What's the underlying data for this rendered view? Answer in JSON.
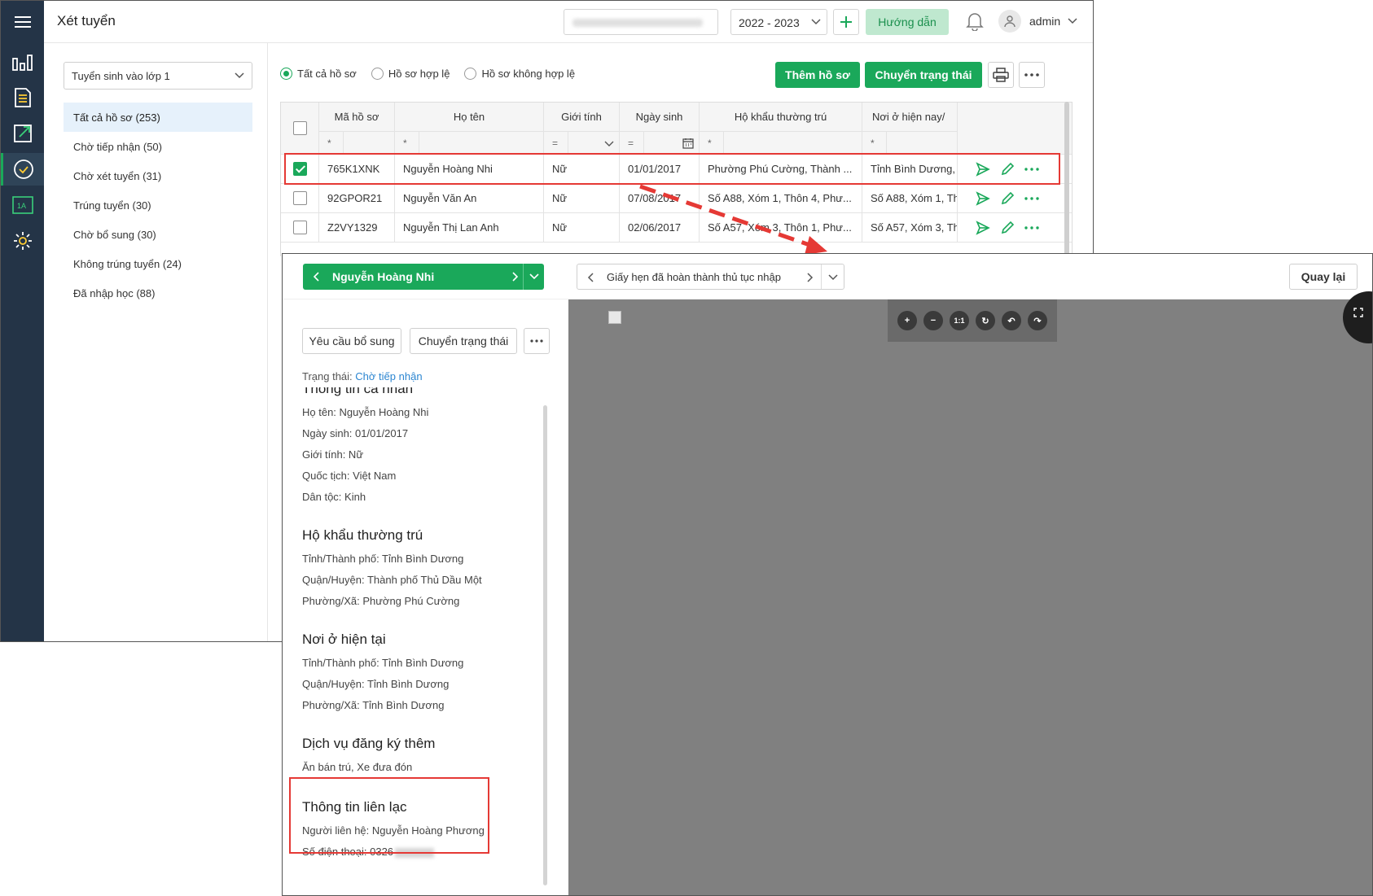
{
  "app": {
    "page_title": "Xét tuyển",
    "school_select_value": "",
    "year": "2022 - 2023",
    "guide_label": "Hướng dẫn",
    "user": "admin"
  },
  "nav_icons": [
    "dashboard-chart-icon",
    "document-list-icon",
    "export-icon",
    "check-circle-icon",
    "class-1a-icon",
    "settings-gear-icon"
  ],
  "left": {
    "admission_select": "Tuyển sinh vào lớp 1",
    "categories": [
      {
        "label": "Tất cả hồ sơ (253)"
      },
      {
        "label": "Chờ tiếp nhận (50)"
      },
      {
        "label": "Chờ xét tuyển (31)"
      },
      {
        "label": "Trúng tuyển (30)"
      },
      {
        "label": "Chờ bổ sung (30)"
      },
      {
        "label": "Không trúng tuyển (24)"
      },
      {
        "label": "Đã nhập học (88)"
      }
    ]
  },
  "filters": {
    "all": "Tất cả hồ sơ",
    "valid": "Hồ sơ hợp lệ",
    "invalid": "Hồ sơ không hợp lệ"
  },
  "toolbar": {
    "add_label": "Thêm hồ sơ",
    "change_status_label": "Chuyển trạng thái"
  },
  "table": {
    "headers": [
      "Mã hồ sơ",
      "Họ tên",
      "Giới tính",
      "Ngày sinh",
      "Hộ khẩu thường trú",
      "Nơi ở hiện nay/ "
    ],
    "filter_ops": [
      "*",
      "*",
      "=",
      "=",
      "*",
      "*"
    ],
    "rows": [
      {
        "code": "765K1XNK",
        "name": "Nguyễn Hoàng Nhi",
        "gender": "Nữ",
        "dob": "01/01/2017",
        "address": "Phường Phú Cường, Thành ...",
        "current": "Tỉnh Bình Dương,",
        "checked": true
      },
      {
        "code": "92GPOR21",
        "name": "Nguyễn Văn An",
        "gender": "Nữ",
        "dob": "07/08/2017",
        "address": "Số A88, Xóm 1, Thôn 4, Phư...",
        "current": "Số A88, Xóm 1, Th",
        "checked": false
      },
      {
        "code": "Z2VY1329",
        "name": "Nguyễn Thị Lan Anh",
        "gender": "Nữ",
        "dob": "02/06/2017",
        "address": "Số A57, Xóm 3, Thôn 1, Phư...",
        "current": "Số A57, Xóm 3, Th",
        "checked": false
      }
    ]
  },
  "detail": {
    "student_name": "Nguyễn Hoàng Nhi",
    "document": "Giấy hẹn đã hoàn thành thủ tục nhập",
    "back_label": "Quay lại",
    "request_label": "Yêu cầu bổ sung",
    "change_status_label": "Chuyển trạng thái",
    "status_label": "Trạng thái:",
    "status_value": "Chờ tiếp nhận",
    "sections": [
      {
        "title": "Thông tin cá nhân",
        "items": [
          "Họ tên: Nguyễn Hoàng Nhi",
          "Ngày sinh: 01/01/2017",
          "Giới tính: Nữ",
          "Quốc tịch: Việt Nam",
          "Dân tộc: Kinh"
        ]
      },
      {
        "title": "Hộ khẩu thường trú",
        "items": [
          "Tỉnh/Thành phố: Tỉnh Bình Dương",
          "Quận/Huyện: Thành phố Thủ Dầu Một",
          "Phường/Xã: Phường Phú Cường"
        ]
      },
      {
        "title": "Nơi ở hiện tại",
        "items": [
          "Tỉnh/Thành phố: Tỉnh Bình Dương",
          "Quận/Huyện: Tỉnh Bình Dương",
          "Phường/Xã: Tỉnh Bình Dương"
        ]
      },
      {
        "title": "Dịch vụ đăng ký thêm",
        "items": [
          "Ăn bán trú, Xe đưa đón"
        ]
      }
    ],
    "contact": {
      "title": "Thông tin liên lạc",
      "person": "Người liên hệ: Nguyễn Hoàng Phương",
      "phone": "Số điện thoại: 0326"
    },
    "viewer_tools": [
      "+",
      "−",
      "1:1",
      "↻",
      "↶",
      "↷"
    ]
  },
  "colors": {
    "accent": "#1aa85a",
    "rail": "#243447",
    "highlight": "#e53935",
    "link": "#2c86d1"
  }
}
